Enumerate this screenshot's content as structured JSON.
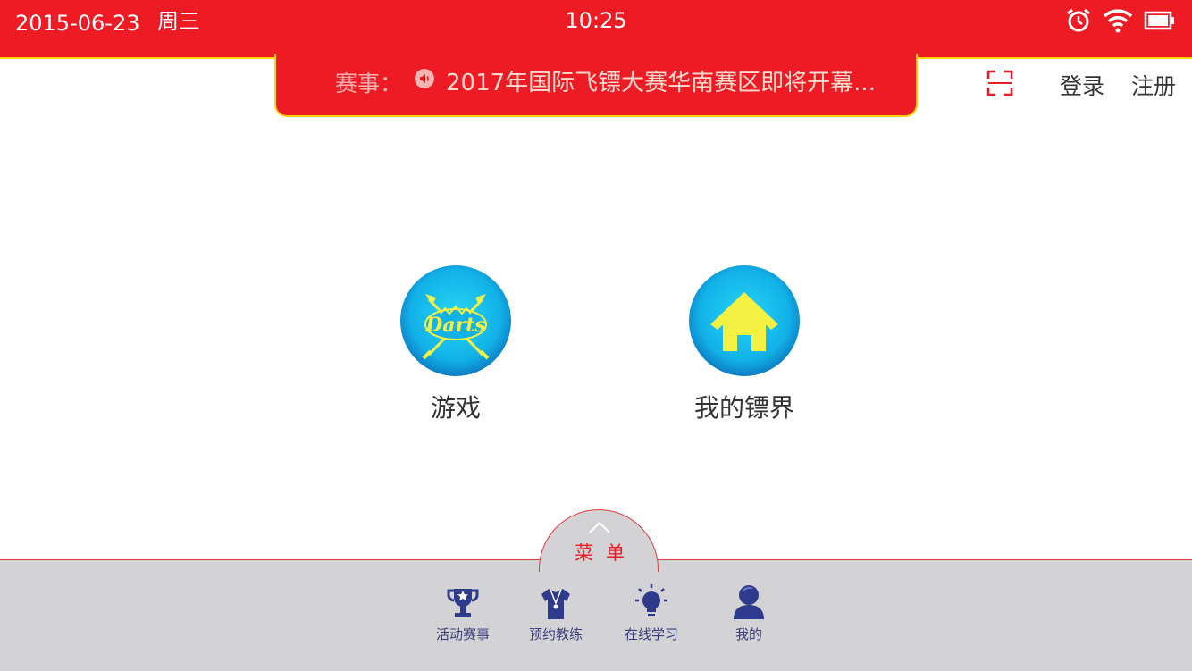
{
  "status_bar": {
    "date": "2015-06-23",
    "weekday": "周三",
    "time": "10:25",
    "icons": [
      "alarm-icon",
      "wifi-icon",
      "battery-icon"
    ]
  },
  "ticker": {
    "label": "赛事：",
    "text": "2017年国际飞镖大赛华南赛区即将开幕..."
  },
  "header_actions": {
    "login": "登录",
    "register": "注册"
  },
  "tiles": [
    {
      "label": "游戏",
      "icon": "darts-logo-icon"
    },
    {
      "label": "我的镖界",
      "icon": "home-icon"
    }
  ],
  "menu_tab": {
    "label": "菜单"
  },
  "bottom_nav": [
    {
      "label": "活动赛事",
      "icon": "trophy-icon"
    },
    {
      "label": "预约教练",
      "icon": "coach-shirt-icon"
    },
    {
      "label": "在线学习",
      "icon": "lightbulb-icon"
    },
    {
      "label": "我的",
      "icon": "user-icon"
    }
  ],
  "colors": {
    "brand_red": "#ed1c24",
    "accent_yellow": "#ffd400",
    "nav_icon": "#2e3a8c",
    "tile_blue": "#12b1e8"
  }
}
